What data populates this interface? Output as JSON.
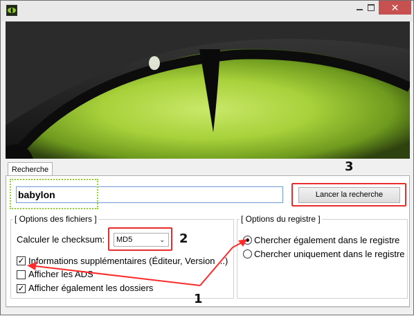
{
  "window": {
    "colors": {
      "accent_red": "#e82c2c",
      "accent_green": "#8fd22a",
      "close": "#c75050"
    },
    "icons": {
      "app": "eye-icon",
      "minimize": "minimize-icon",
      "maximize": "maximize-icon",
      "close": "close-icon"
    }
  },
  "tabs": [
    {
      "label": "Recherche"
    }
  ],
  "search": {
    "value": "babylon",
    "button_label": "Lancer la recherche"
  },
  "file_options": {
    "title": "[ Options des fichiers ]",
    "checksum_label": "Calculer le checksum:",
    "checksum_value": "MD5",
    "checkboxes": [
      {
        "label": "Informations supplémentaires (Éditeur, Version ...)",
        "checked": true
      },
      {
        "label": "Afficher les ADS",
        "checked": false
      },
      {
        "label": "Afficher également les dossiers",
        "checked": true
      }
    ]
  },
  "registry_options": {
    "title": "[ Options du registre ]",
    "radios": [
      {
        "label": "Chercher également dans le registre",
        "selected": true
      },
      {
        "label": "Chercher uniquement dans le registre",
        "selected": false
      }
    ]
  },
  "annotations": {
    "n1": "1",
    "n2": "2",
    "n3": "3"
  }
}
